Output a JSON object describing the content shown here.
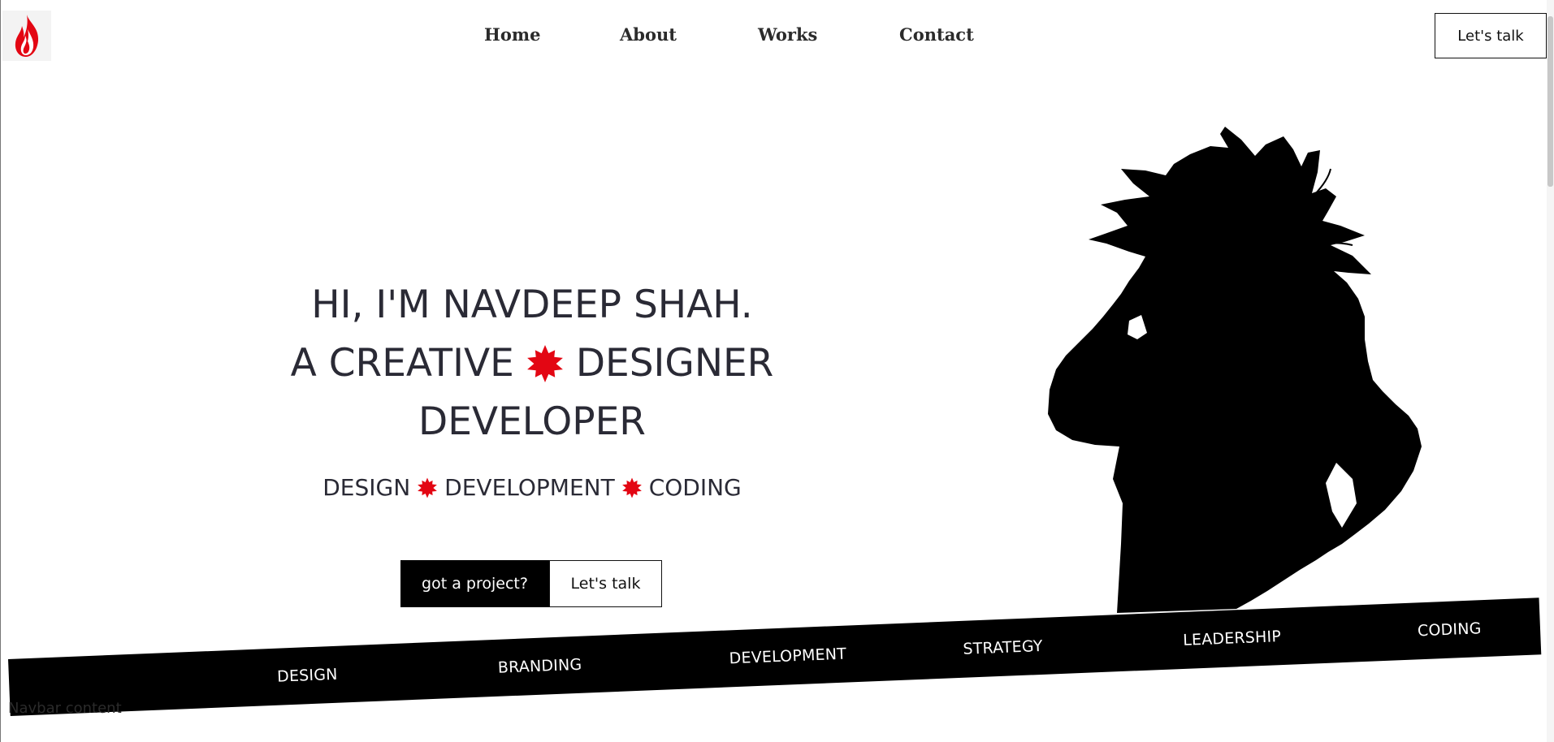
{
  "navbar": {
    "logo_icon": "flame-icon",
    "links": [
      "Home",
      "About",
      "Works",
      "Contact"
    ],
    "cta_label": "Let's talk"
  },
  "hero": {
    "line1": "HI, I'M NAVDEEP SHAH.",
    "line2_left": "A CREATIVE",
    "line2_right": "DESIGNER",
    "line3": "DEVELOPER",
    "skills": [
      "DESIGN",
      "DEVELOPMENT",
      "CODING"
    ],
    "star_icon": "star-burst-icon",
    "project_button": "got a project?",
    "talk_button": "Let's talk"
  },
  "ribbon": {
    "items": [
      "DESIGN",
      "BRANDING",
      "DEVELOPMENT",
      "STRATEGY",
      "LEADERSHIP",
      "CODING"
    ]
  },
  "navbar_note": "Navbar content",
  "colors": {
    "accent": "#e30613",
    "dark": "#000000",
    "text": "#2a2a35"
  }
}
